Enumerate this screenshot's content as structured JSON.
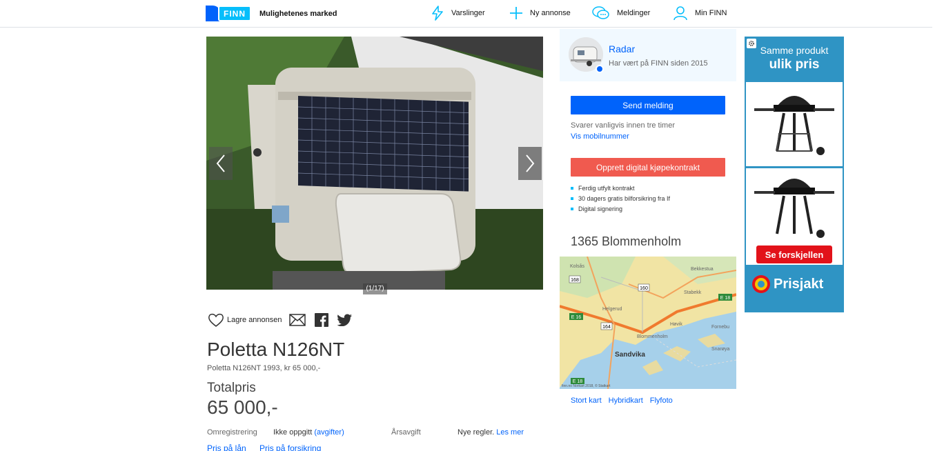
{
  "header": {
    "logo_text": "FINN",
    "tagline": "Mulighetenes marked",
    "nav": [
      {
        "label": "Varslinger",
        "icon": "bolt-icon"
      },
      {
        "label": "Ny annonse",
        "icon": "plus-icon"
      },
      {
        "label": "Meldinger",
        "icon": "chat-icon"
      },
      {
        "label": "Min FINN",
        "icon": "user-icon"
      }
    ]
  },
  "gallery": {
    "counter": "(1/17)",
    "prev_icon": "chevron-left-icon",
    "next_icon": "chevron-right-icon"
  },
  "share": {
    "save_label": "Lagre annonsen",
    "icons": [
      "heart-icon",
      "mail-icon",
      "facebook-icon",
      "twitter-icon"
    ]
  },
  "listing": {
    "title": "Poletta N126NT",
    "subtitle": "Poletta N126NT 1993, kr 65 000,-",
    "price_label": "Totalpris",
    "price": "65 000,-",
    "details": {
      "omreg_key": "Omregistrering",
      "omreg_val": "Ikke oppgitt",
      "omreg_link": "(avgifter)",
      "arsavgift_key": "Årsavgift",
      "arsavgift_val": "Nye regler.",
      "arsavgift_link": "Les mer"
    },
    "bottom_links": [
      "Pris på lån",
      "Pris på forsikring"
    ]
  },
  "seller": {
    "name": "Radar",
    "since": "Har vært på FINN siden 2015",
    "send_button": "Send melding",
    "reply_time": "Svarer vanligvis innen tre timer",
    "phone_link": "Vis mobilnummer",
    "contract_button": "Opprett digital kjøpekontrakt",
    "bullets": [
      "Ferdig utfylt kontrakt",
      "30 dagers gratis bilforsikring fra If",
      "Digital signering"
    ]
  },
  "location": {
    "title": "1365 Blommenholm",
    "map_labels": {
      "city": "Sandvika",
      "road_168": "168",
      "road_160": "160",
      "road_164": "164",
      "e16": "E 16",
      "e18": "E 18",
      "e18b": "E 18",
      "kolsas": "Kolsås",
      "bekkestua": "Bekkestua",
      "helgerud": "Helgerud",
      "stabekk": "Stabekk",
      "hovik": "Høvik",
      "fornebu": "Fornebu",
      "blommenholm": "Blommenholm",
      "snaroya": "Snarøya",
      "copyright": "finn.no Norkart 2018, © Statkart"
    },
    "links": [
      "Stort kart",
      "Hybridkart",
      "Flyfoto"
    ]
  },
  "ad": {
    "line1": "Samme produkt",
    "line2": "ulik pris",
    "cta": "Se forskjellen",
    "brand": "Prisjakt"
  },
  "colors": {
    "finn_blue": "#0063fb",
    "finn_cyan": "#06befb",
    "contract_red": "#f05a4f",
    "ad_blue": "#2f94c4"
  }
}
